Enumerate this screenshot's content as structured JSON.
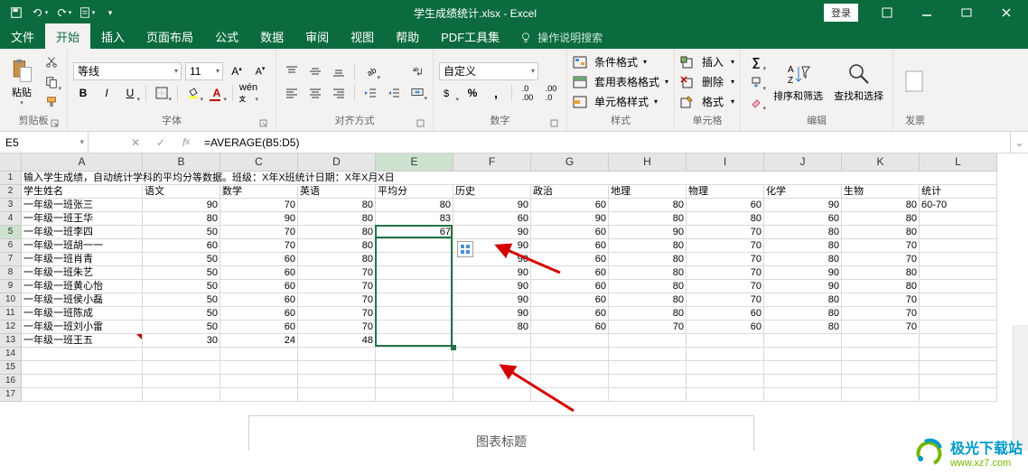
{
  "title": "学生成绩统计.xlsx - Excel",
  "login": "登录",
  "qat": {
    "save": "save",
    "undo": "undo",
    "redo": "redo",
    "quick": "quick"
  },
  "tabs": {
    "file": "文件",
    "home": "开始",
    "insert": "插入",
    "pagelayout": "页面布局",
    "formulas": "公式",
    "data": "数据",
    "review": "审阅",
    "view": "视图",
    "help": "帮助",
    "pdf": "PDF工具集",
    "tellme": "操作说明搜索"
  },
  "ribbon": {
    "clipboard": {
      "paste": "粘贴",
      "label": "剪贴板"
    },
    "font": {
      "name": "等线",
      "size": "11",
      "label": "字体"
    },
    "align": {
      "label": "对齐方式"
    },
    "number": {
      "fmt": "自定义",
      "label": "数字"
    },
    "styles": {
      "cond": "条件格式",
      "tbl": "套用表格格式",
      "cell": "单元格样式",
      "label": "样式"
    },
    "cells": {
      "ins": "插入",
      "del": "删除",
      "fmt": "格式",
      "label": "单元格"
    },
    "editing": {
      "sort": "排序和筛选",
      "find": "查找和选择",
      "label": "编辑"
    },
    "addin": {
      "label": "发票"
    }
  },
  "namebox": "E5",
  "formula": "=AVERAGE(B5:D5)",
  "chart_title": "图表标题",
  "watermark": {
    "main": "极光下载站",
    "url": "www.xz7.com"
  },
  "chart_data": {
    "type": "table",
    "title_row": "输入学生成绩，自动统计学科的平均分等数据。班级：X年X班统计日期：X年X月X日",
    "columns": [
      "学生姓名",
      "语文",
      "数学",
      "英语",
      "平均分",
      "历史",
      "政治",
      "地理",
      "物理",
      "化学",
      "生物",
      "统计"
    ],
    "stat_header": "60-70",
    "rows": [
      {
        "name": "一年级一班张三",
        "v": [
          90,
          70,
          80,
          80,
          90,
          60,
          80,
          60,
          90,
          80
        ]
      },
      {
        "name": "一年级一班王华",
        "v": [
          80,
          90,
          80,
          83,
          60,
          90,
          80,
          80,
          60,
          80
        ]
      },
      {
        "name": "一年级一班李四",
        "v": [
          50,
          70,
          80,
          67,
          90,
          60,
          90,
          70,
          80,
          80
        ]
      },
      {
        "name": "一年级一班胡一一",
        "v": [
          60,
          70,
          80,
          null,
          90,
          60,
          80,
          70,
          80,
          70
        ]
      },
      {
        "name": "一年级一班肖青",
        "v": [
          50,
          60,
          80,
          null,
          90,
          60,
          80,
          70,
          80,
          70
        ]
      },
      {
        "name": "一年级一班朱艺",
        "v": [
          50,
          60,
          70,
          null,
          90,
          60,
          80,
          70,
          90,
          80
        ]
      },
      {
        "name": "一年级一班黄心怡",
        "v": [
          50,
          60,
          70,
          null,
          90,
          60,
          80,
          70,
          90,
          80
        ]
      },
      {
        "name": "一年级一班侯小磊",
        "v": [
          50,
          60,
          70,
          null,
          90,
          60,
          80,
          70,
          80,
          70
        ]
      },
      {
        "name": "一年级一班陈成",
        "v": [
          50,
          60,
          70,
          null,
          90,
          60,
          80,
          60,
          80,
          70
        ]
      },
      {
        "name": "一年级一班刘小雷",
        "v": [
          50,
          60,
          70,
          null,
          80,
          60,
          70,
          60,
          80,
          70
        ]
      },
      {
        "name": "一年级一班王五",
        "v": [
          30,
          24,
          48,
          null,
          null,
          null,
          null,
          null,
          null,
          null
        ]
      }
    ]
  }
}
